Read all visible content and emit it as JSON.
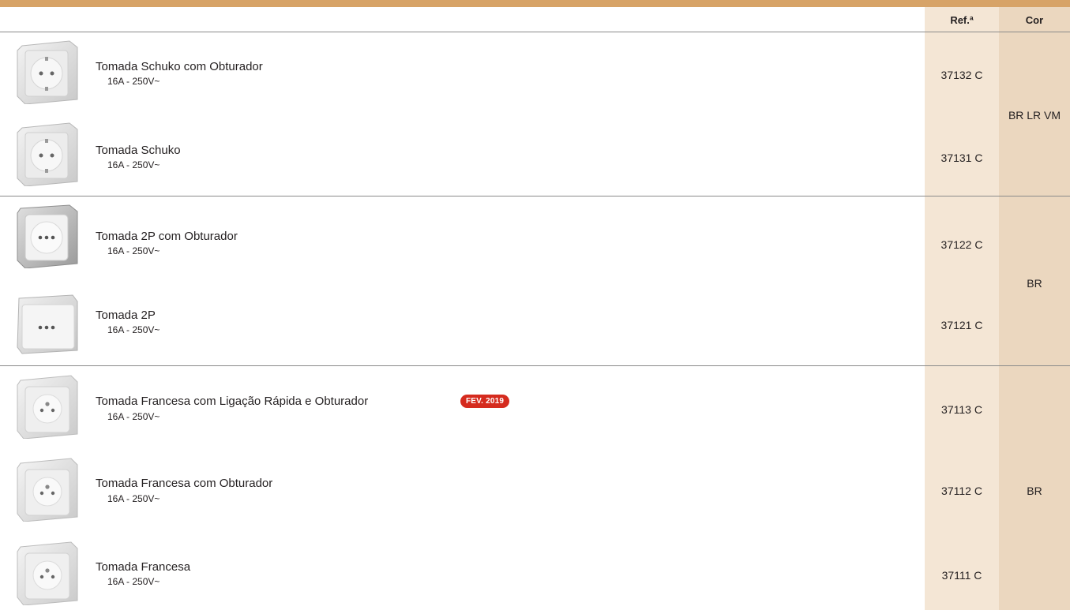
{
  "headers": {
    "ref": "Ref.ª",
    "cor": "Cor"
  },
  "products": [
    {
      "name": "Tomada Schuko com Obturador",
      "spec": "16A - 250V~",
      "ref": "37132 C",
      "icon": "schuko-socket-icon"
    },
    {
      "name": "Tomada Schuko",
      "spec": "16A - 250V~",
      "ref": "37131 C",
      "icon": "schuko-socket-icon"
    },
    {
      "name": "Tomada 2P com Obturador",
      "spec": "16A - 250V~",
      "ref": "37122 C",
      "icon": "2p-socket-icon"
    },
    {
      "name": "Tomada 2P",
      "spec": "16A - 250V~",
      "ref": "37121 C",
      "icon": "2p-socket-icon"
    },
    {
      "name": "Tomada Francesa com Ligação Rápida e Obturador",
      "spec": "16A - 250V~",
      "ref": "37113 C",
      "icon": "french-socket-icon",
      "badge": "FEV. 2019"
    },
    {
      "name": "Tomada Francesa com Obturador",
      "spec": "16A - 250V~",
      "ref": "37112 C",
      "icon": "french-socket-icon"
    },
    {
      "name": "Tomada Francesa",
      "spec": "16A - 250V~",
      "ref": "37111 C",
      "icon": "french-socket-icon"
    }
  ],
  "colors_groups": [
    "BR LR VM",
    "BR",
    "BR"
  ],
  "colors": {
    "accent": "#d7a367",
    "ref_col": "#f4e6d5",
    "cor_col": "#ebd7bf",
    "badge": "#d52b1e"
  }
}
